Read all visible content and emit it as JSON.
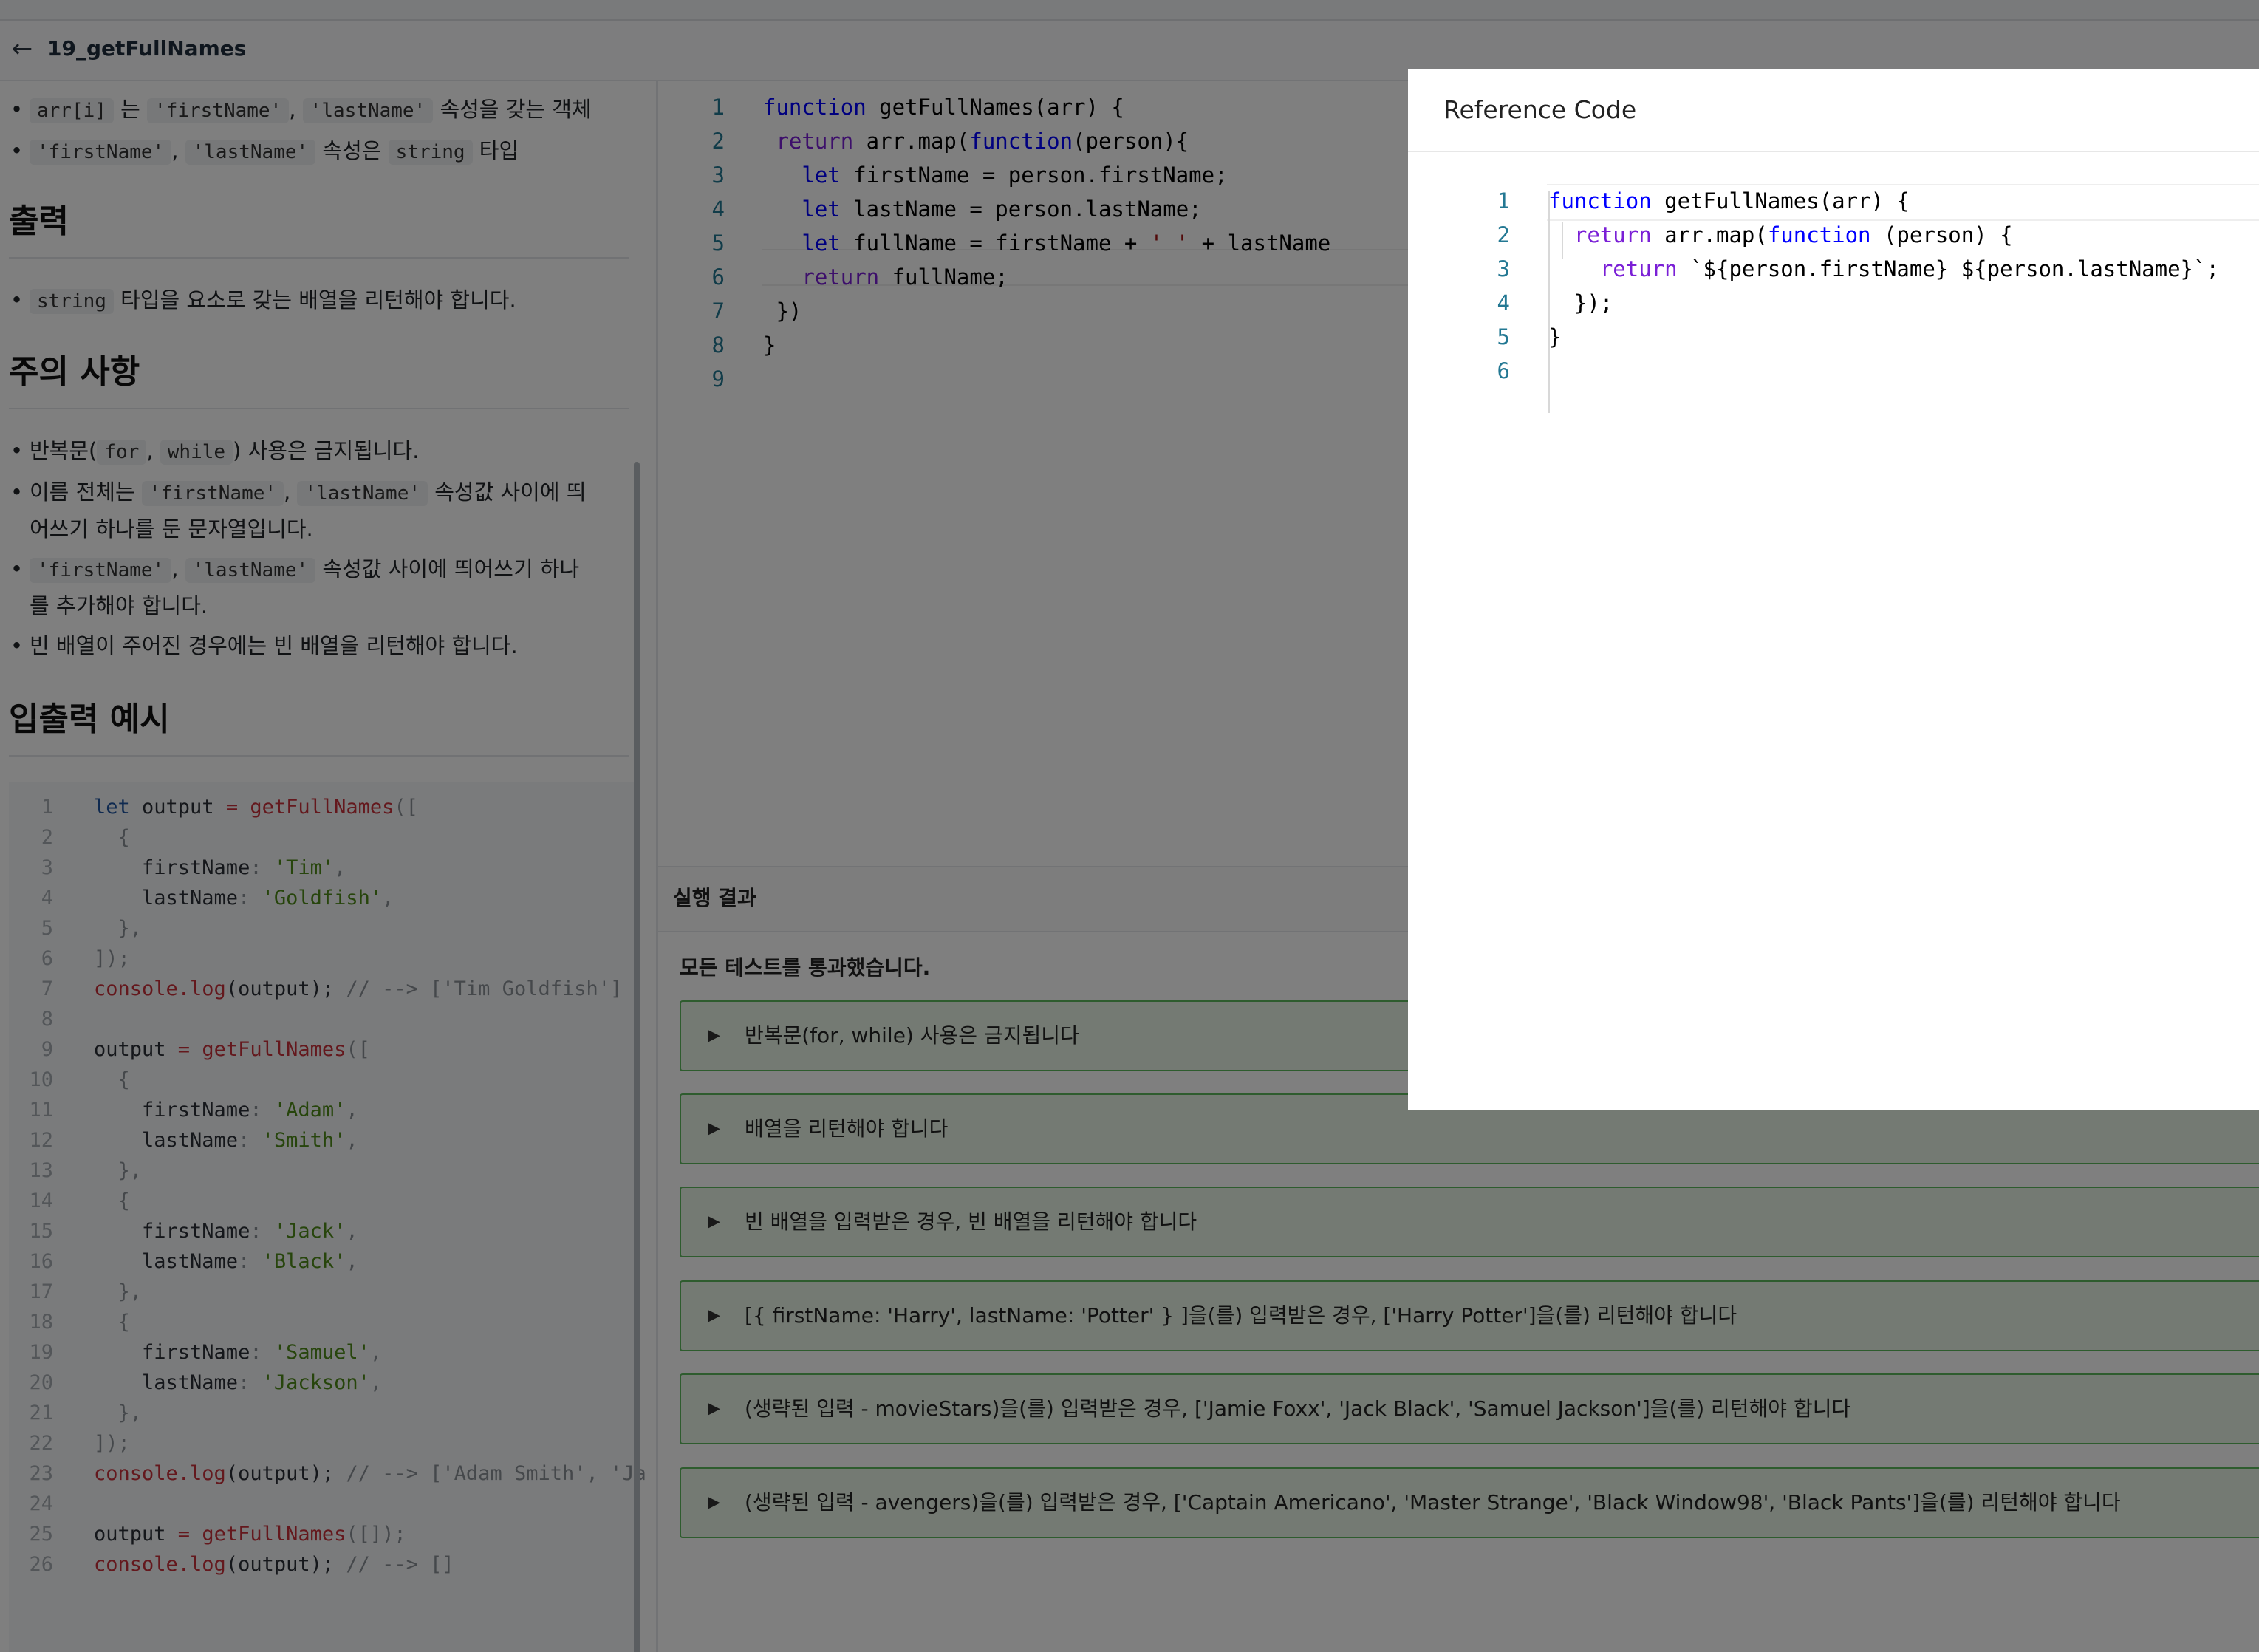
{
  "header": {
    "back_icon": "arrow-left-icon",
    "title": "19_getFullNames"
  },
  "description": {
    "input_bullets": [
      {
        "code1": "arr[i]",
        "text1": "는",
        "code2": "'firstName'",
        "sep": ",",
        "code3": "'lastName'",
        "text2": "속성을 갖는 객체"
      },
      {
        "code1": "'firstName'",
        "sep": ",",
        "code2": "'lastName'",
        "text1": "속성은",
        "code3": "string",
        "text2": "타입"
      }
    ],
    "output_heading": "출력",
    "output_bullets": [
      {
        "code1": "string",
        "text1": "타입을 요소로 갖는 배열을 리턴해야 합니다."
      }
    ],
    "notes_heading": "주의 사항",
    "notes_bullets": {
      "b1": {
        "text1": "반복문(",
        "code1": "for",
        "sep": ",",
        "code2": "while",
        "text2": ") 사용은 금지됩니다."
      },
      "b2": {
        "text1": "이름 전체는",
        "code1": "'firstName'",
        "sep": ",",
        "code2": "'lastName'",
        "text2": "속성값 사이에 띄",
        "text3": "어쓰기 하나를 둔 문자열입니다."
      },
      "b3": {
        "code1": "'firstName'",
        "sep": ",",
        "code2": "'lastName'",
        "text1": "속성값 사이에 띄어쓰기 하나",
        "text2": "를 추가해야 합니다."
      },
      "b4": {
        "text1": "빈 배열이 주어진 경우에는 빈 배열을 리턴해야 합니다."
      }
    },
    "example_heading": "입출력 예시",
    "example_lines": [
      "1",
      "2",
      "3",
      "4",
      "5",
      "6",
      "7",
      "8",
      "9",
      "10",
      "11",
      "12",
      "13",
      "14",
      "15",
      "16",
      "17",
      "18",
      "19",
      "20",
      "21",
      "22",
      "23",
      "24",
      "25",
      "26"
    ],
    "example_code": {
      "l1_kw": "let",
      "l1_var": " output ",
      "l1_op": "=",
      "l1_fn": " getFullNames",
      "l1_rest": "([",
      "l2": "  {",
      "l3_key": "    firstName",
      "l3_colon": ": ",
      "l3_val": "'Tim'",
      "l3_end": ",",
      "l4_key": "    lastName",
      "l4_colon": ": ",
      "l4_val": "'Goldfish'",
      "l4_end": ",",
      "l5": "  },",
      "l6": "]);",
      "l7_fn": "console.log",
      "l7_mid": "(output); ",
      "l7_cm": "// --> ['Tim Goldfish']",
      "l9_var": "output ",
      "l9_op": "=",
      "l9_fn": " getFullNames",
      "l9_rest": "([",
      "l10": "  {",
      "l11_key": "    firstName",
      "l11_colon": ": ",
      "l11_val": "'Adam'",
      "l11_end": ",",
      "l12_key": "    lastName",
      "l12_colon": ": ",
      "l12_val": "'Smith'",
      "l12_end": ",",
      "l13": "  },",
      "l14": "  {",
      "l15_key": "    firstName",
      "l15_colon": ": ",
      "l15_val": "'Jack'",
      "l15_end": ",",
      "l16_key": "    lastName",
      "l16_colon": ": ",
      "l16_val": "'Black'",
      "l16_end": ",",
      "l17": "  },",
      "l18": "  {",
      "l19_key": "    firstName",
      "l19_colon": ": ",
      "l19_val": "'Samuel'",
      "l19_end": ",",
      "l20_key": "    lastName",
      "l20_colon": ": ",
      "l20_val": "'Jackson'",
      "l20_end": ",",
      "l21": "  },",
      "l22": "]);",
      "l23_fn": "console.log",
      "l23_mid": "(output); ",
      "l23_cm": "// --> ['Adam Smith', 'Ja",
      "l25_var": "output ",
      "l25_op": "=",
      "l25_fn": " getFullNames",
      "l25_rest": "([]);",
      "l26_fn": "console.log",
      "l26_mid": "(output); ",
      "l26_cm": "// --> []"
    }
  },
  "editor": {
    "line_numbers": [
      "1",
      "2",
      "3",
      "4",
      "5",
      "6",
      "7",
      "8",
      "9"
    ],
    "l1_kw": "function",
    "l1_rest": " getFullNames(arr) {",
    "l2_kw": " return",
    "l2_mid": " arr.map(",
    "l2_fn": "function",
    "l2_rest": "(person){",
    "l3_kw": "   let",
    "l3_rest": " firstName = person.firstName;",
    "l4_kw": "   let",
    "l4_rest": " lastName = person.lastName;",
    "l5_kw": "   let",
    "l5_mid": " fullName = firstName + ",
    "l5_str": "' '",
    "l5_rest": " + lastName",
    "l6_kw": "   return",
    "l6_rest": " fullName;",
    "l7": " })",
    "l8": "}",
    "l9": ""
  },
  "results": {
    "tab_label": "실행 결과",
    "summary": "모든 테스트를 통과했습니다.",
    "expand_icon": "caret-right-icon",
    "tests": [
      "반복문(for, while) 사용은 금지됩니다",
      "배열을 리턴해야 합니다",
      "빈 배열을 입력받은 경우, 빈 배열을 리턴해야 합니다",
      "[{ firstName: 'Harry', lastName: 'Potter' } ]을(를) 입력받은 경우, ['Harry Potter']을(를) 리턴해야 합니다",
      "(생략된 입력 - movieStars)을(를) 입력받은 경우, ['Jamie Foxx', 'Jack Black', 'Samuel Jackson']을(를) 리턴해야 합니다",
      "(생략된 입력 - avengers)을(를) 입력받은 경우, ['Captain Americano', 'Master Strange', 'Black Window98', 'Black Pants']을(를) 리턴해야 합니다"
    ]
  },
  "modal": {
    "title": "Reference Code",
    "line_numbers": [
      "1",
      "2",
      "3",
      "4",
      "5",
      "6"
    ],
    "l1_kw": "function",
    "l1_rest": " getFullNames(arr) {",
    "l2_kw": "  return",
    "l2_mid": " arr.map(",
    "l2_fn": "function",
    "l2_rest": " (person) {",
    "l3_kw": "    return",
    "l3_rest": " `${person.firstName} ${person.lastName}`;",
    "l4": "  });",
    "l5": "}",
    "l6": ""
  },
  "colors": {
    "overlay": "rgba(0,0,0,0.5)",
    "test_pass_bg": "#e8f5e6",
    "test_pass_border": "#5cb85c",
    "keyword_blue": "#0000ff",
    "line_number": "#237893"
  }
}
